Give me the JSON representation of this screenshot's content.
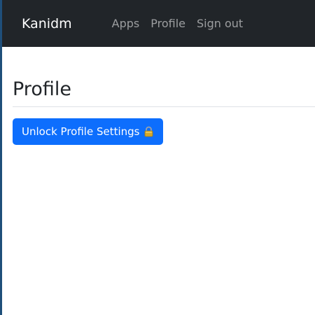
{
  "navbar": {
    "brand": "Kanidm",
    "links": [
      {
        "label": "Apps"
      },
      {
        "label": "Profile"
      },
      {
        "label": "Sign out"
      }
    ]
  },
  "main": {
    "title": "Profile",
    "unlock_button": {
      "label": "Unlock Profile Settings",
      "icon": "lock-icon"
    }
  },
  "colors": {
    "navbar_bg": "#212529",
    "button_bg": "#0d6efd",
    "frame_border": "#1f4f7a"
  }
}
